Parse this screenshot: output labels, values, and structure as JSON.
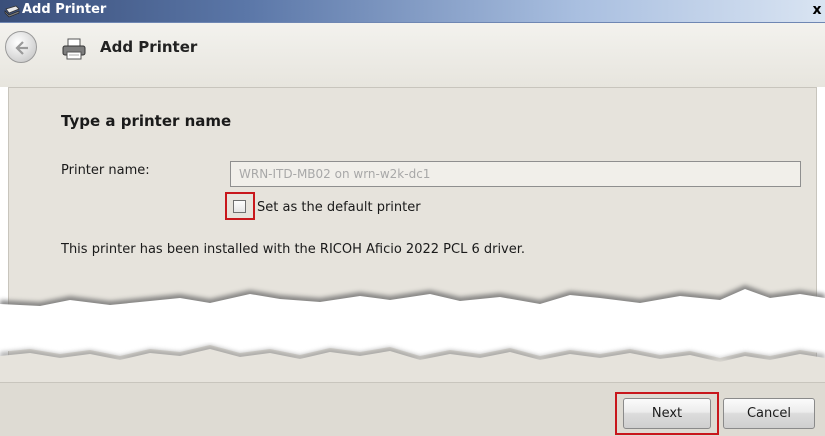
{
  "window": {
    "title": "Add Printer",
    "close_glyph": "x",
    "title_icon": "printer-icon"
  },
  "header": {
    "title": "Add Printer",
    "back_icon": "back-arrow-icon",
    "icon": "printer-icon"
  },
  "main": {
    "heading": "Type a printer name",
    "printer_name_label": "Printer name:",
    "printer_name_value": "WRN-ITD-MB02 on wrn-w2k-dc1",
    "default_checkbox_label": "Set as the default printer",
    "default_checkbox_checked": false,
    "info_text": "This printer has been installed with the RICOH Aficio 2022 PCL 6 driver."
  },
  "footer": {
    "next_label": "Next",
    "cancel_label": "Cancel"
  },
  "colors": {
    "highlight_border": "#c8171c",
    "panel_background": "#e6e3dc",
    "titlebar_start": "#3a4f7a"
  }
}
